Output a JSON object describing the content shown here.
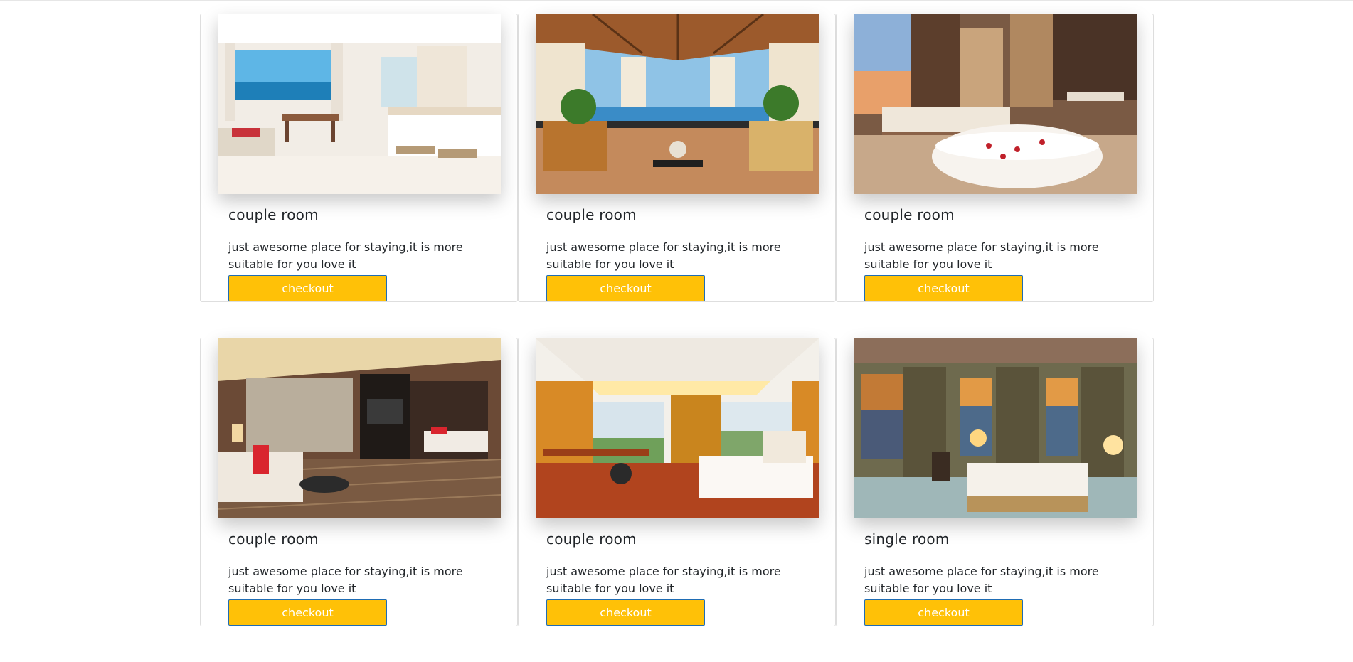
{
  "rooms": [
    {
      "title": "couple room",
      "description": "just awesome place for staying,it is more suitable for you love it",
      "button_label": "checkout",
      "image": "seaview-suite-photo"
    },
    {
      "title": "couple room",
      "description": "just awesome place for staying,it is more suitable for you love it",
      "button_label": "checkout",
      "image": "gazebo-terrace-photo"
    },
    {
      "title": "couple room",
      "description": "just awesome place for staying,it is more suitable for you love it",
      "button_label": "checkout",
      "image": "bathtub-suite-photo"
    },
    {
      "title": "couple room",
      "description": "just awesome place for staying,it is more suitable for you love it",
      "button_label": "checkout",
      "image": "living-suite-photo"
    },
    {
      "title": "couple room",
      "description": "just awesome place for staying,it is more suitable for you love it",
      "button_label": "checkout",
      "image": "wood-floor-suite-photo"
    },
    {
      "title": "single room",
      "description": "just awesome place for staying,it is more suitable for you love it",
      "button_label": "checkout",
      "image": "classic-mountain-room-photo"
    }
  ],
  "colors": {
    "button_bg": "#ffc107",
    "button_border": "#1f6cb4",
    "card_border": "#dedede"
  }
}
